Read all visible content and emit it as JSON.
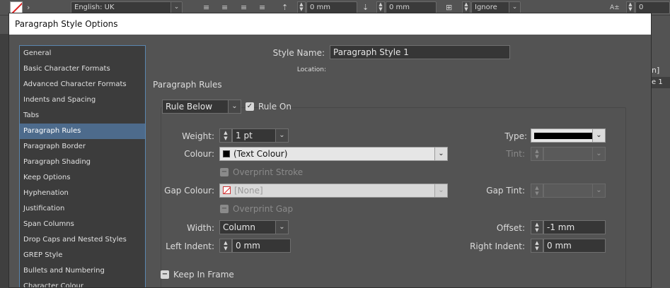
{
  "app_toolbar": {
    "language": "English: UK",
    "indent_value_1": "0 mm",
    "indent_value_2": "0 mm",
    "align_mode": "Ignore",
    "right_value": "0"
  },
  "background": {
    "right_bracket_text": "n]",
    "right_selected_text": "e 1"
  },
  "dialog": {
    "title": "Paragraph Style Options",
    "style_name_label": "Style Name:",
    "style_name_value": "Paragraph Style 1",
    "location_label": "Location:",
    "section_title": "Paragraph Rules",
    "categories": [
      "General",
      "Basic Character Formats",
      "Advanced Character Formats",
      "Indents and Spacing",
      "Tabs",
      "Paragraph Rules",
      "Paragraph Border",
      "Paragraph Shading",
      "Keep Options",
      "Hyphenation",
      "Justification",
      "Span Columns",
      "Drop Caps and Nested Styles",
      "GREP Style",
      "Bullets and Numbering",
      "Character Colour"
    ],
    "selected_category": "Paragraph Rules",
    "rule_type": "Rule Below",
    "rule_on_label": "Rule On",
    "rule_on_checked": true,
    "weight_label": "Weight:",
    "weight_value": "1 pt",
    "type_label": "Type:",
    "colour_label": "Colour:",
    "colour_value": "(Text Colour)",
    "tint_label": "Tint:",
    "overprint_stroke_label": "Overprint Stroke",
    "gap_colour_label": "Gap Colour:",
    "gap_colour_value": "[None]",
    "gap_tint_label": "Gap Tint:",
    "overprint_gap_label": "Overprint Gap",
    "width_label": "Width:",
    "width_value": "Column",
    "offset_label": "Offset:",
    "offset_value": "-1 mm",
    "left_indent_label": "Left Indent:",
    "left_indent_value": "0 mm",
    "right_indent_label": "Right Indent:",
    "right_indent_value": "0 mm",
    "keep_in_frame_label": "Keep In Frame"
  },
  "icons": {
    "checkmark": "✓",
    "minus": "−",
    "dropdown": "⌄",
    "step_up": "▲",
    "step_down": "▼"
  }
}
